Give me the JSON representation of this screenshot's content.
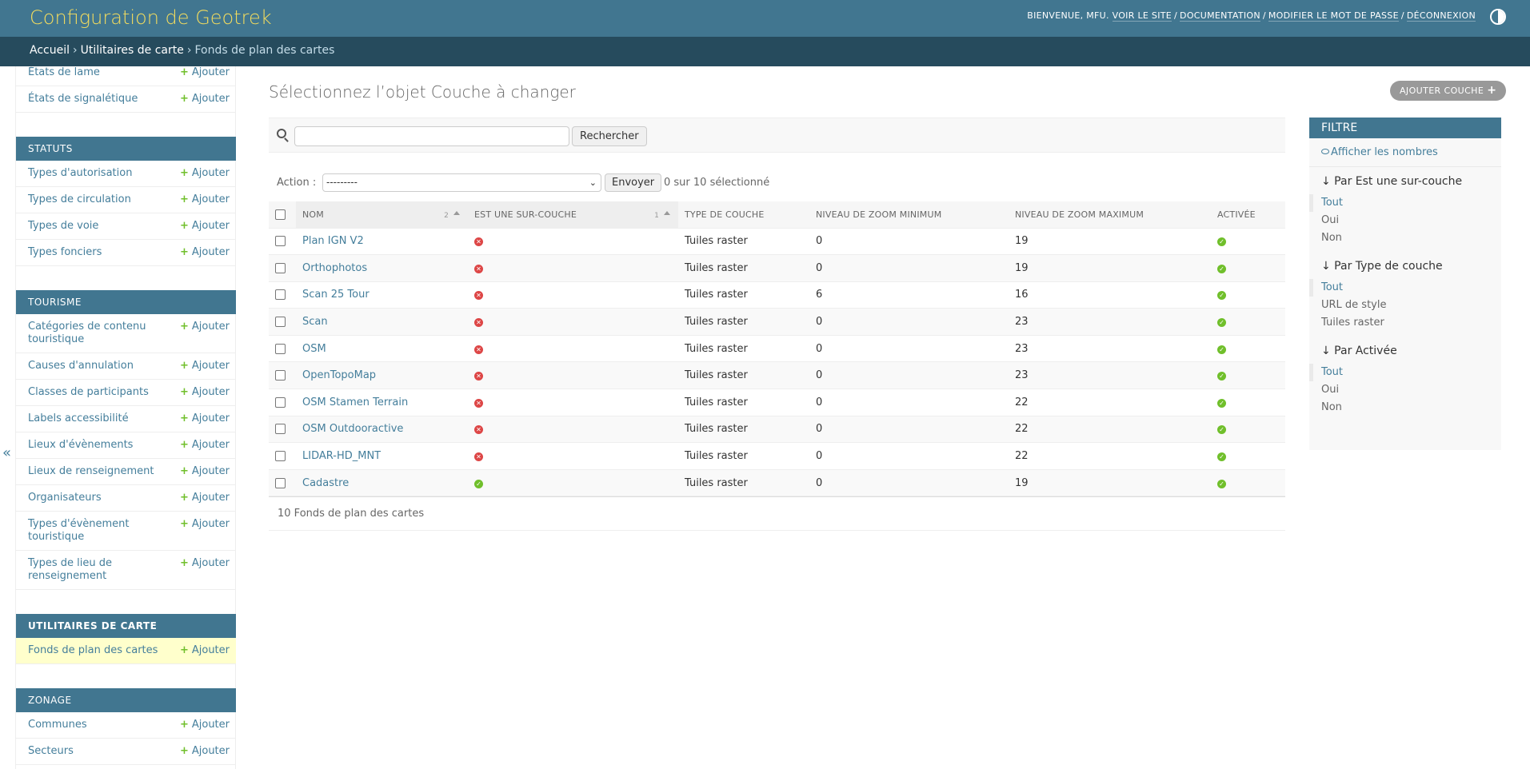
{
  "header": {
    "site_title": "Configuration de Geotrek",
    "welcome": "BIENVENUE, MFU.",
    "links": [
      "VOIR LE SITE",
      "DOCUMENTATION",
      "MODIFIER LE MOT DE PASSE",
      "DÉCONNEXION"
    ]
  },
  "breadcrumbs": {
    "home": "Accueil",
    "app": "Utilitaires de carte",
    "current": "Fonds de plan des cartes"
  },
  "sidebar": {
    "add_label": "Ajouter",
    "top_items": [
      "États de lame",
      "États de signalétique"
    ],
    "modules": [
      {
        "caption": "STATUTS",
        "items": [
          "Types d'autorisation",
          "Types de circulation",
          "Types de voie",
          "Types fonciers"
        ]
      },
      {
        "caption": "TOURISME",
        "items": [
          "Catégories de contenu touristique",
          "Causes d'annulation",
          "Classes de participants",
          "Labels accessibilité",
          "Lieux d'évènements",
          "Lieux de renseignement",
          "Organisateurs",
          "Types d'évènement touristique",
          "Types de lieu de renseignement"
        ]
      },
      {
        "caption": "UTILITAIRES DE CARTE",
        "items": [
          "Fonds de plan des cartes"
        ]
      },
      {
        "caption": "ZONAGE",
        "items": [
          "Communes",
          "Secteurs"
        ]
      }
    ],
    "collapse": "«"
  },
  "content": {
    "title": "Sélectionnez l’objet Couche à changer",
    "add_button": "AJOUTER COUCHE",
    "search_button": "Rechercher",
    "action_label": "Action :",
    "action_select": "---------",
    "action_go": "Envoyer",
    "action_counter": "0 sur 10 sélectionné",
    "paginator": "10 Fonds de plan des cartes"
  },
  "table": {
    "columns": [
      "NOM",
      "EST UNE SUR-COUCHE",
      "TYPE DE COUCHE",
      "NIVEAU DE ZOOM MINIMUM",
      "NIVEAU DE ZOOM MAXIMUM",
      "ACTIVÉE"
    ],
    "sort_nom": "2",
    "sort_overlay": "1",
    "rows": [
      {
        "name": "Plan IGN V2",
        "overlay": false,
        "type": "Tuiles raster",
        "min": "0",
        "max": "19",
        "active": true
      },
      {
        "name": "Orthophotos",
        "overlay": false,
        "type": "Tuiles raster",
        "min": "0",
        "max": "19",
        "active": true
      },
      {
        "name": "Scan 25 Tour",
        "overlay": false,
        "type": "Tuiles raster",
        "min": "6",
        "max": "16",
        "active": true
      },
      {
        "name": "Scan",
        "overlay": false,
        "type": "Tuiles raster",
        "min": "0",
        "max": "23",
        "active": true
      },
      {
        "name": "OSM",
        "overlay": false,
        "type": "Tuiles raster",
        "min": "0",
        "max": "23",
        "active": true
      },
      {
        "name": "OpenTopoMap",
        "overlay": false,
        "type": "Tuiles raster",
        "min": "0",
        "max": "23",
        "active": true
      },
      {
        "name": "OSM Stamen Terrain",
        "overlay": false,
        "type": "Tuiles raster",
        "min": "0",
        "max": "22",
        "active": true
      },
      {
        "name": "OSM Outdooractive",
        "overlay": false,
        "type": "Tuiles raster",
        "min": "0",
        "max": "22",
        "active": true
      },
      {
        "name": "LIDAR-HD_MNT",
        "overlay": false,
        "type": "Tuiles raster",
        "min": "0",
        "max": "22",
        "active": true
      },
      {
        "name": "Cadastre",
        "overlay": true,
        "type": "Tuiles raster",
        "min": "0",
        "max": "19",
        "active": true
      }
    ]
  },
  "filter": {
    "title": "FILTRE",
    "show_counts": "Afficher les nombres",
    "groups": [
      {
        "heading": "↓ Par Est une sur-couche",
        "options": [
          "Tout",
          "Oui",
          "Non"
        ]
      },
      {
        "heading": "↓ Par Type de couche",
        "options": [
          "Tout",
          "URL de style",
          "Tuiles raster"
        ]
      },
      {
        "heading": "↓ Par Activée",
        "options": [
          "Tout",
          "Oui",
          "Non"
        ]
      }
    ]
  },
  "colors": {
    "header": "#417690",
    "breadcrumbs": "#264b5d",
    "link": "#447e9b",
    "title_yellow": "#f5dd5d",
    "yes": "#70bf2b",
    "no": "#dd4646"
  }
}
